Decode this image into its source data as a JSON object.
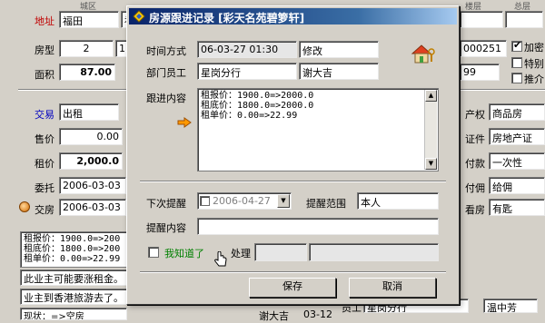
{
  "background_form": {
    "header": {
      "district": "城区",
      "floor": "楼层",
      "total": "总层"
    },
    "address_label": "地址",
    "address_value": "福田",
    "address_value2": "福",
    "room_type_label": "房型",
    "room_type_value": "2",
    "room_type_value2": "1",
    "area_label": "面积",
    "area_value": "87.00",
    "phone_partial": "000251",
    "floor_partial": "99",
    "encrypt_label": "加密",
    "special_label": "特别",
    "recommend_label": "推介",
    "trade_label": "交易",
    "trade_value": "出租",
    "property_label": "产权",
    "property_value": "商品房",
    "sale_price_label": "售价",
    "sale_price_value": "0.00",
    "cert_label": "证件",
    "cert_value": "房地产证",
    "rent_label": "租价",
    "rent_value": "2,000.0",
    "pay_label": "付款",
    "pay_value": "一次性",
    "entrust_label": "委托",
    "entrust_value": "2006-03-03",
    "commission_label": "付佣",
    "commission_value": "给佣",
    "deliver_label": "交房",
    "deliver_value": "2006-03-03",
    "view_label": "看房",
    "view_value": "有匙",
    "memo_lines": [
      "租报价：1900.0=>200",
      "租底价：1800.0=>200",
      "租单价：0.00=>22.99"
    ],
    "note1": "此业主可能要涨租金。",
    "note2": "业主到香港旅游去了。",
    "note3": "现状：=>空房",
    "staff_label": "员工",
    "staff_value": "星岗分行",
    "staff_person": "温中芳",
    "bottom_person": "谢大吉",
    "bottom_date": "03-12"
  },
  "dialog": {
    "title": "房源跟进记录 [彩天名苑碧箩轩]",
    "close_glyph": "✕",
    "time_method_label": "时间方式",
    "time_value": "06-03-27 01:30",
    "method_value": "修改",
    "dept_label": "部门员工",
    "dept_value": "星岗分行",
    "employee_value": "谢大吉",
    "content_label": "跟进内容",
    "content_lines": [
      "租报价：1900.0=>2000.0",
      "租底价：1800.0=>2000.0",
      "租单价：0.00=>22.99"
    ],
    "next_remind_label": "下次提醒",
    "next_remind_date": "2006-04-27",
    "remind_range_label": "提醒范围",
    "remind_range_value": "本人",
    "remind_content_label": "提醒内容",
    "remind_content_value": "",
    "i_know_label": "我知道了",
    "handle_label": "处理",
    "save_label": "保存",
    "cancel_label": "取消"
  },
  "colors": {
    "title_start": "#0a246a",
    "title_end": "#a6caf0",
    "red_label": "#c00000",
    "blue_label": "#0000c0"
  }
}
